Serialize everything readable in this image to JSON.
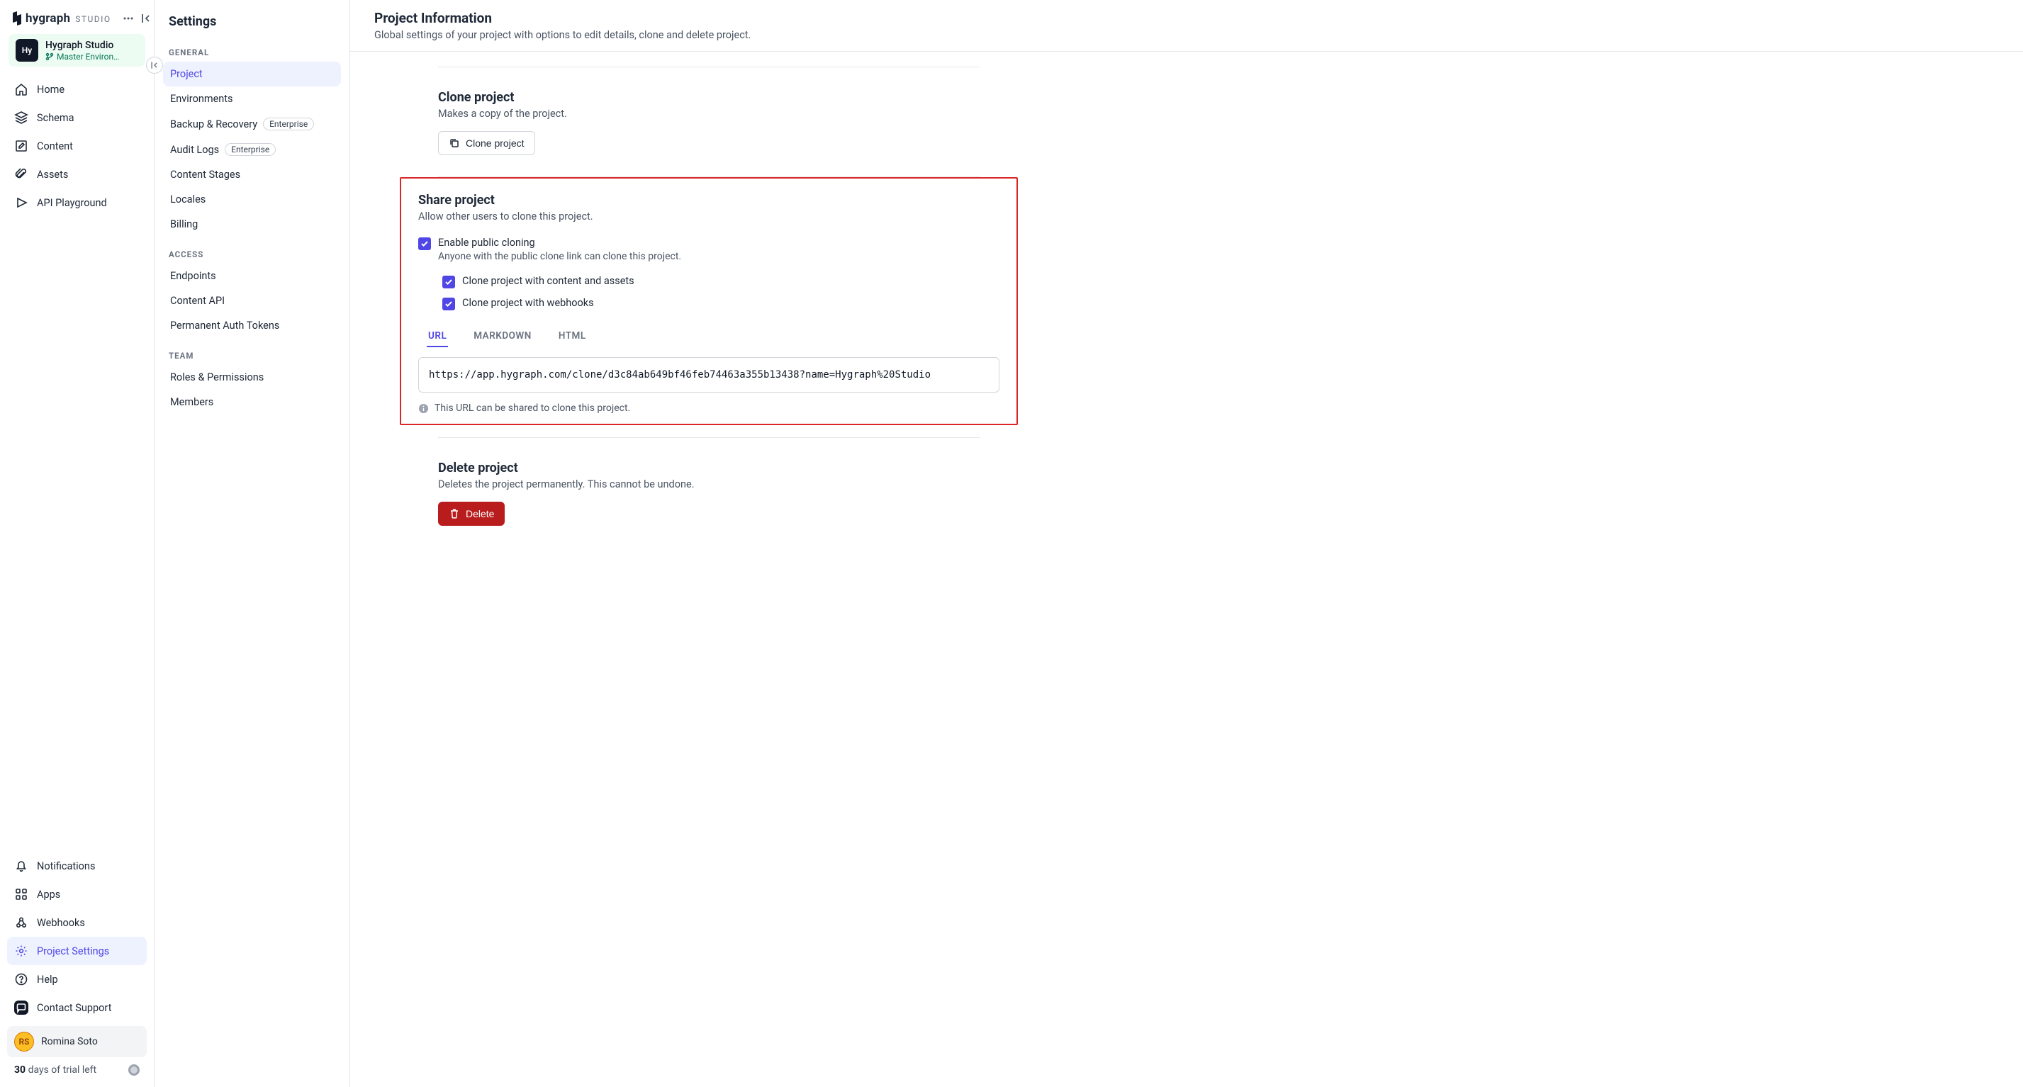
{
  "brand": {
    "name": "hygraph",
    "suffix": "STUDIO"
  },
  "project": {
    "avatar": "Hy",
    "name": "Hygraph Studio",
    "env": "Master Environ…"
  },
  "nav": {
    "home": "Home",
    "schema": "Schema",
    "content": "Content",
    "assets": "Assets",
    "playground": "API Playground",
    "notifications": "Notifications",
    "apps": "Apps",
    "webhooks": "Webhooks",
    "settings": "Project Settings",
    "help": "Help",
    "support": "Contact Support"
  },
  "user": {
    "name": "Romina Soto"
  },
  "trial": {
    "days": "30",
    "suffix": "days of trial left"
  },
  "settings": {
    "title": "Settings",
    "groups": {
      "general": {
        "label": "GENERAL",
        "project": "Project",
        "environments": "Environments",
        "backup": "Backup & Recovery",
        "audit": "Audit Logs",
        "stages": "Content Stages",
        "locales": "Locales",
        "billing": "Billing"
      },
      "access": {
        "label": "ACCESS",
        "endpoints": "Endpoints",
        "contentapi": "Content API",
        "tokens": "Permanent Auth Tokens"
      },
      "team": {
        "label": "TEAM",
        "roles": "Roles & Permissions",
        "members": "Members"
      }
    },
    "enterprise_badge": "Enterprise"
  },
  "page": {
    "title": "Project Information",
    "subtitle": "Global settings of your project with options to edit details, clone and delete project."
  },
  "clone": {
    "title": "Clone project",
    "desc": "Makes a copy of the project.",
    "button": "Clone project"
  },
  "share": {
    "title": "Share project",
    "desc": "Allow other users to clone this project.",
    "enable_label": "Enable public cloning",
    "enable_help": "Anyone with the public clone link can clone this project.",
    "opt_content": "Clone project with content and assets",
    "opt_webhooks": "Clone project with webhooks",
    "tabs": {
      "url": "URL",
      "markdown": "MARKDOWN",
      "html": "HTML"
    },
    "url_value": "https://app.hygraph.com/clone/d3c84ab649bf46feb74463a355b13438?name=Hygraph%20Studio",
    "hint": "This URL can be shared to clone this project."
  },
  "delete": {
    "title": "Delete project",
    "desc": "Deletes the project permanently. This cannot be undone.",
    "button": "Delete"
  }
}
